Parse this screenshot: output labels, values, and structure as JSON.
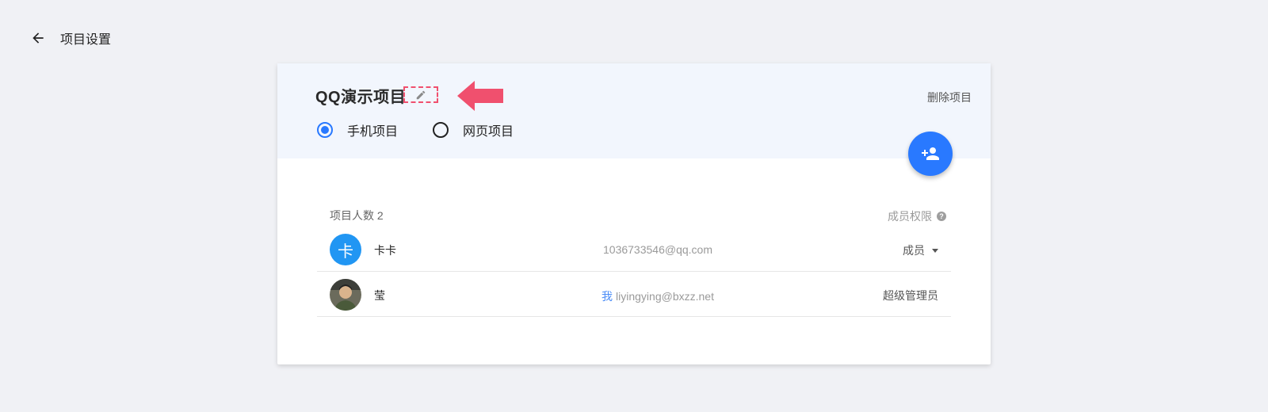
{
  "header": {
    "title": "项目设置",
    "back_icon": "arrow-left-icon"
  },
  "project": {
    "name": "QQ演示项目",
    "edit_icon": "pencil-icon",
    "delete_label": "删除项目",
    "types": [
      {
        "label": "手机项目",
        "selected": true
      },
      {
        "label": "网页项目",
        "selected": false
      }
    ],
    "add_member_icon": "person-add-icon"
  },
  "members": {
    "count_label": "项目人数 2",
    "permissions_label": "成员权限",
    "help_icon": "question-icon",
    "rows": [
      {
        "avatar_text": "卡",
        "name": "卡卡",
        "me_tag": "",
        "email": "1036733546@qq.com",
        "role": "成员",
        "role_editable": true
      },
      {
        "avatar_text": "",
        "name": "莹",
        "me_tag": "我",
        "email": "liyingying@bxzz.net",
        "role": "超级管理员",
        "role_editable": false
      }
    ]
  },
  "colors": {
    "accent": "#2979ff",
    "annotation": "#f0506e",
    "header_bg": "#f2f6fd",
    "page_bg": "#f0f1f5"
  }
}
